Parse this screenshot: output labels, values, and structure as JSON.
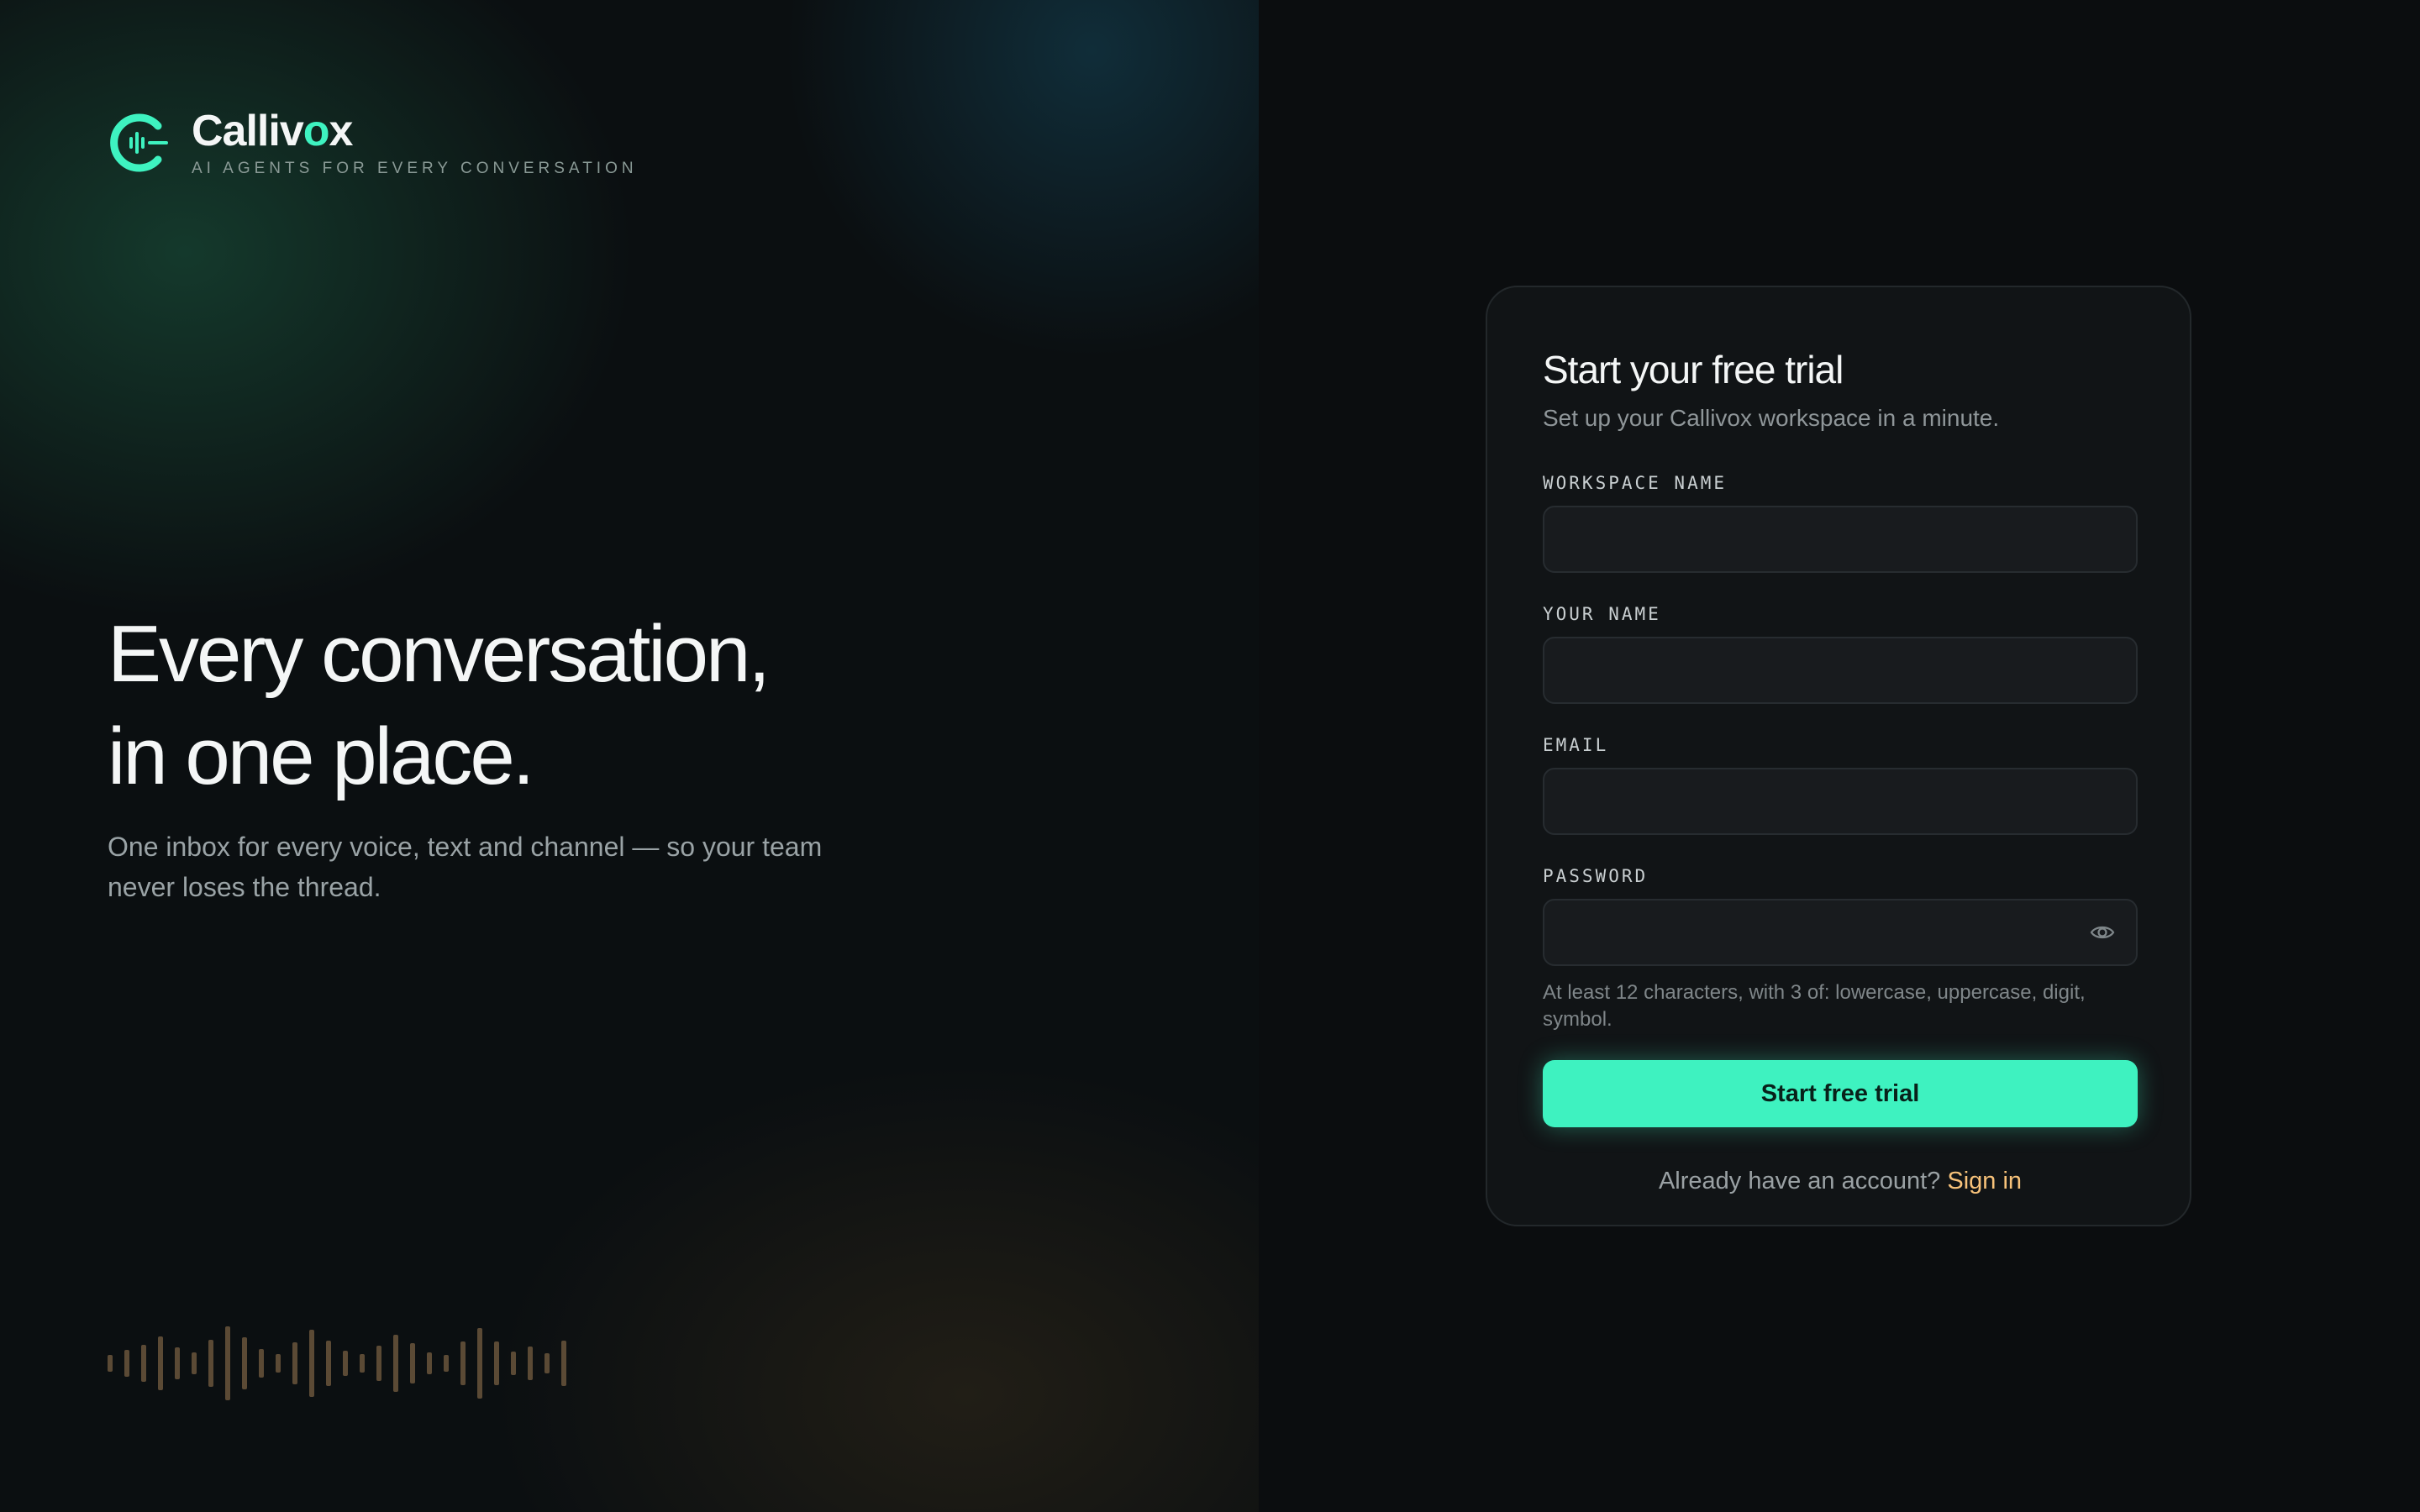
{
  "brand": {
    "name_prefix": "Calliv",
    "name_accent": "o",
    "name_suffix": "x",
    "tagline": "AI AGENTS FOR EVERY CONVERSATION",
    "accent_color": "#3ef2c0"
  },
  "hero": {
    "title_line1": "Every conversation,",
    "title_line2": "in one place.",
    "subtitle": "One inbox for every voice, text and channel — so your team never loses the thread."
  },
  "signup": {
    "title": "Start your free trial",
    "subtitle": "Set up your Callivox workspace in a minute.",
    "fields": {
      "workspace": {
        "label": "WORKSPACE NAME",
        "value": ""
      },
      "name": {
        "label": "YOUR NAME",
        "value": ""
      },
      "email": {
        "label": "EMAIL",
        "value": ""
      },
      "password": {
        "label": "PASSWORD",
        "value": "",
        "hint": "At least 12 characters, with 3 of: lowercase, uppercase, digit, symbol.",
        "toggle_icon": "eye-icon"
      }
    },
    "submit_label": "Start free trial",
    "signin_prompt": "Already have an account?",
    "signin_link": "Sign in",
    "button_color": "#3ef2c0",
    "link_color": "#f7c27a"
  },
  "waveform": {
    "icon": "audio-waveform",
    "levels": [
      0.22,
      0.36,
      0.5,
      0.72,
      0.44,
      0.3,
      0.64,
      1.0,
      0.7,
      0.38,
      0.26,
      0.56,
      0.9,
      0.62,
      0.34,
      0.24,
      0.48,
      0.78,
      0.54,
      0.3,
      0.22,
      0.6,
      0.96,
      0.58,
      0.32,
      0.46,
      0.28,
      0.62
    ]
  }
}
